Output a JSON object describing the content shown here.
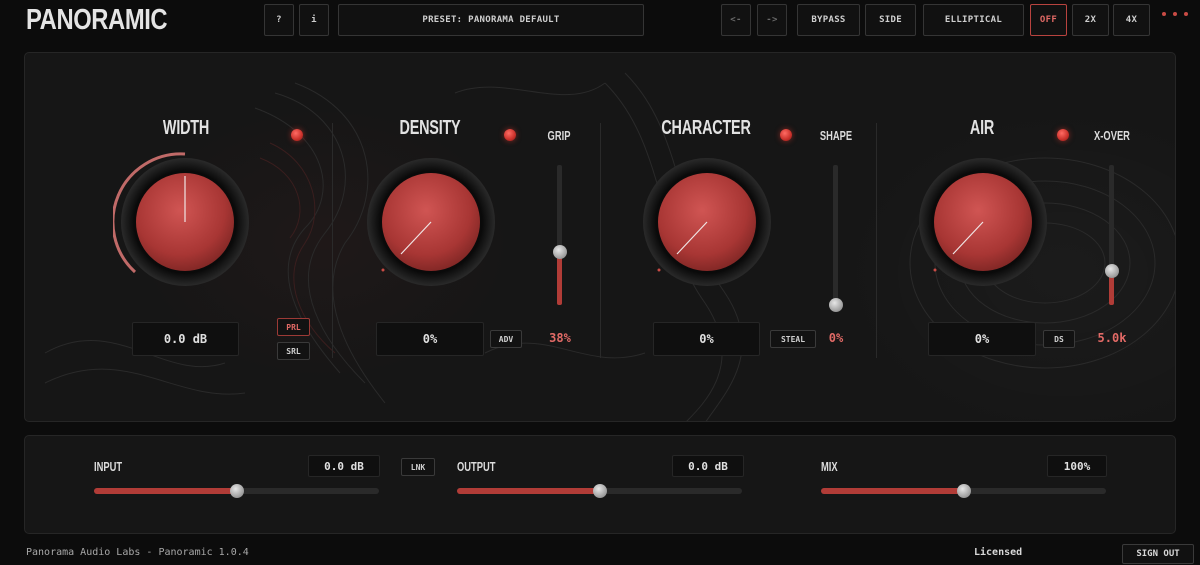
{
  "app": {
    "title": "PANORAMIC"
  },
  "toolbar": {
    "help_label": "?",
    "info_label": "i",
    "preset": "PRESET: PANORAMA DEFAULT",
    "prev_label": "<-",
    "next_label": "->",
    "bypass_label": "BYPASS",
    "side_label": "SIDE",
    "mode_label": "ELLIPTICAL",
    "oversample": [
      {
        "label": "OFF",
        "active": true
      },
      {
        "label": "2X",
        "active": false
      },
      {
        "label": "4X",
        "active": false
      }
    ]
  },
  "sections": {
    "width": {
      "title": "WIDTH",
      "value": "0.0 dB",
      "buttons": [
        {
          "label": "PRL",
          "active": true
        },
        {
          "label": "SRL",
          "active": false
        }
      ]
    },
    "density": {
      "title": "DENSITY",
      "value": "0%",
      "button": "ADV",
      "slider_title": "GRIP",
      "slider_value": "38%",
      "slider_level": 0.38
    },
    "character": {
      "title": "CHARACTER",
      "value": "0%",
      "button": "STEAL",
      "slider_title": "SHAPE",
      "slider_value": "0%",
      "slider_level": 0.0
    },
    "air": {
      "title": "AIR",
      "value": "0%",
      "button": "DS",
      "slider_title": "X-OVER",
      "slider_value": "5.0k",
      "slider_level": 0.24
    }
  },
  "io": {
    "input": {
      "label": "INPUT",
      "value": "0.0 dB",
      "level": 0.5
    },
    "link_label": "LNK",
    "output": {
      "label": "OUTPUT",
      "value": "0.0 dB",
      "level": 0.5
    },
    "mix": {
      "label": "MIX",
      "value": "100%",
      "level": 0.5
    }
  },
  "footer": {
    "company": "Panorama Audio Labs - Panoramic 1.0.4",
    "license": "Licensed",
    "signout_label": "SIGN OUT"
  },
  "colors": {
    "accent": "#c94b45",
    "knob": "#b83a38",
    "background": "#0c0c0c",
    "panel": "#161616"
  }
}
